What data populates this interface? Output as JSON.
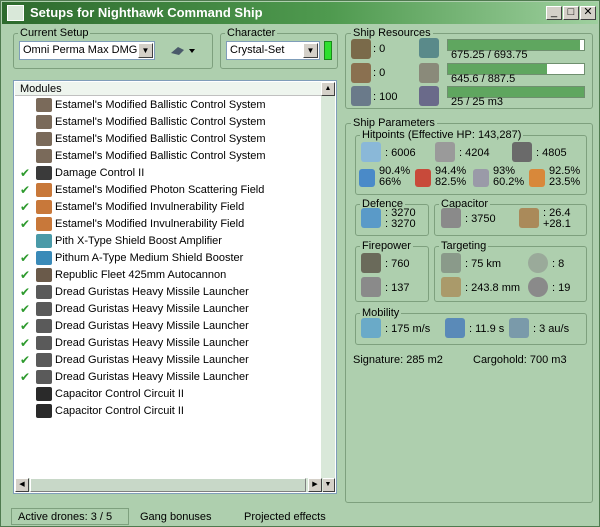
{
  "window": {
    "title": "Setups for Nighthawk Command Ship"
  },
  "current_setup": {
    "label": "Current Setup",
    "value": "Omni Perma Max DMG"
  },
  "character": {
    "label": "Character",
    "value": "Crystal-Set"
  },
  "modules": {
    "header": "Modules",
    "items": [
      {
        "label": "Estamel's Modified Ballistic Control System",
        "active": false,
        "icon": "ballistic-control-icon"
      },
      {
        "label": "Estamel's Modified Ballistic Control System",
        "active": false,
        "icon": "ballistic-control-icon"
      },
      {
        "label": "Estamel's Modified Ballistic Control System",
        "active": false,
        "icon": "ballistic-control-icon"
      },
      {
        "label": "Estamel's Modified Ballistic Control System",
        "active": false,
        "icon": "ballistic-control-icon"
      },
      {
        "label": "Damage Control II",
        "active": true,
        "icon": "damage-control-icon"
      },
      {
        "label": "Estamel's Modified Photon Scattering Field",
        "active": true,
        "icon": "hardener-icon"
      },
      {
        "label": "Estamel's Modified Invulnerability Field",
        "active": true,
        "icon": "hardener-icon"
      },
      {
        "label": "Estamel's Modified Invulnerability Field",
        "active": true,
        "icon": "hardener-icon"
      },
      {
        "label": "Pith X-Type Shield Boost Amplifier",
        "active": false,
        "icon": "shield-amplifier-icon"
      },
      {
        "label": "Pithum A-Type Medium Shield Booster",
        "active": true,
        "icon": "shield-booster-icon"
      },
      {
        "label": "Republic Fleet 425mm Autocannon",
        "active": true,
        "icon": "autocannon-icon"
      },
      {
        "label": "Dread Guristas Heavy Missile Launcher",
        "active": true,
        "icon": "missile-launcher-icon"
      },
      {
        "label": "Dread Guristas Heavy Missile Launcher",
        "active": true,
        "icon": "missile-launcher-icon"
      },
      {
        "label": "Dread Guristas Heavy Missile Launcher",
        "active": true,
        "icon": "missile-launcher-icon"
      },
      {
        "label": "Dread Guristas Heavy Missile Launcher",
        "active": true,
        "icon": "missile-launcher-icon"
      },
      {
        "label": "Dread Guristas Heavy Missile Launcher",
        "active": true,
        "icon": "missile-launcher-icon"
      },
      {
        "label": "Dread Guristas Heavy Missile Launcher",
        "active": true,
        "icon": "missile-launcher-icon"
      },
      {
        "label": "Capacitor Control Circuit II",
        "active": false,
        "icon": "rig-icon"
      },
      {
        "label": "Capacitor Control Circuit II",
        "active": false,
        "icon": "rig-icon"
      }
    ]
  },
  "statusbar": {
    "drones": "Active drones: 3 / 5",
    "gang": "Gang bonuses",
    "projected": "Projected effects"
  },
  "ship_resources": {
    "label": "Ship Resources",
    "turret": ": 0",
    "launcher": ": 0",
    "calibration": ": 100",
    "cpu": {
      "text": "675.25 / 693.75",
      "fraction": 0.973
    },
    "powergrid": {
      "text": "645.6 / 887.5",
      "fraction": 0.727
    },
    "drone_bay": {
      "text": "25 / 25 m3",
      "fraction": 1.0
    }
  },
  "ship_parameters": {
    "label": "Ship Parameters",
    "hitpoints_label": "Hitpoints (Effective HP: 143,287)",
    "shield_hp": ": 6006",
    "armor_hp": ": 4204",
    "structure_hp": ": 4805",
    "resists": {
      "shield": [
        "90.4%",
        "66%"
      ],
      "armor": [
        "94.4%",
        "82.5%"
      ],
      "structure": [
        "93%",
        "60.2%"
      ],
      "other": [
        "92.5%",
        "23.5%"
      ]
    },
    "defence": {
      "label": "Defence",
      "top": ": 3270",
      "bottom": ": 3270"
    },
    "capacitor": {
      "label": "Capacitor",
      "amount": ": 3750",
      "rate_top": ": 26.4",
      "rate_bottom": "+28.1"
    },
    "firepower": {
      "label": "Firepower",
      "dps": ": 760",
      "volley": ": 137"
    },
    "targeting": {
      "label": "Targeting",
      "range": ": 75 km",
      "max_targets": ": 8",
      "scan": ": 243.8 mm",
      "sensor": ": 19"
    },
    "mobility": {
      "label": "Mobility",
      "speed": ": 175 m/s",
      "align": ": 11.9 s",
      "warp": ": 3 au/s"
    },
    "signature": "Signature: 285 m2",
    "cargohold": "Cargohold: 700 m3"
  },
  "colors": {
    "window_bg": "#aecfae",
    "title_start": "#2d6a2d",
    "bar_fill": "#5fa65f",
    "check": "#2e9a2e"
  }
}
